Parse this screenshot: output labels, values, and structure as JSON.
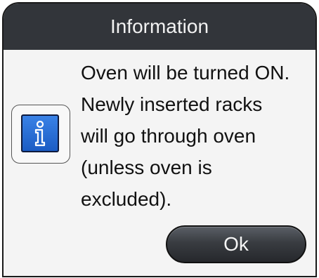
{
  "dialog": {
    "title": "Information",
    "icon": "info-icon",
    "message_lines": [
      "Oven will be turned ON.",
      "Newly inserted racks",
      "will go through oven",
      "(unless oven is",
      "excluded)."
    ],
    "ok_label": "Ok"
  },
  "colors": {
    "title_bar": "#32353a",
    "dialog_bg": "#f4f4f4",
    "icon_blue": "#2a6fd8",
    "button_dark": "#393c41"
  }
}
